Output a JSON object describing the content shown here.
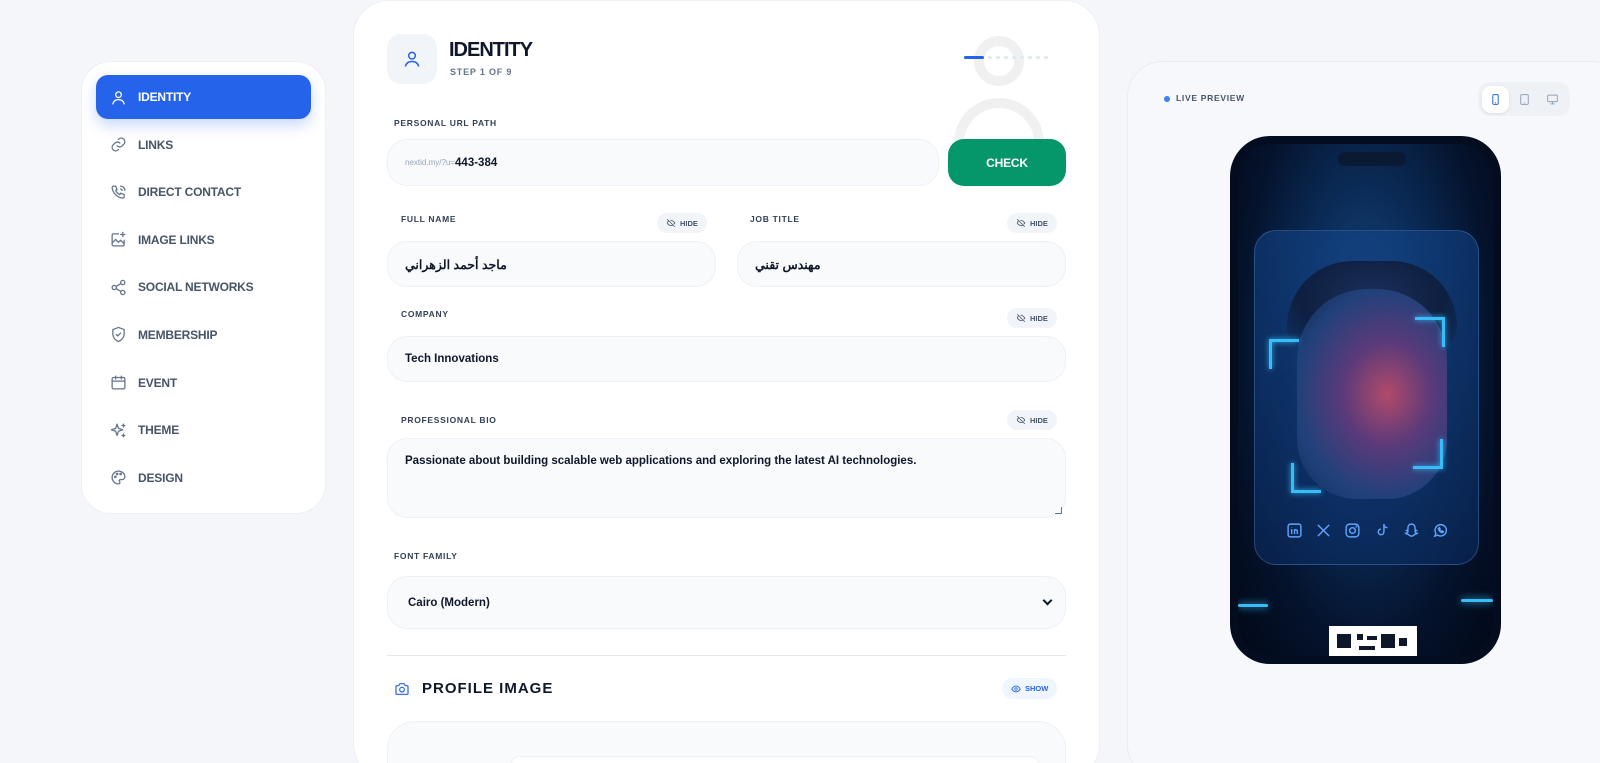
{
  "sidebar": {
    "items": [
      {
        "label": "IDENTITY",
        "icon": "user-icon",
        "active": true
      },
      {
        "label": "LINKS",
        "icon": "link-icon"
      },
      {
        "label": "DIRECT CONTACT",
        "icon": "phone-icon"
      },
      {
        "label": "IMAGE LINKS",
        "icon": "image-plus-icon"
      },
      {
        "label": "SOCIAL NETWORKS",
        "icon": "share-icon"
      },
      {
        "label": "MEMBERSHIP",
        "icon": "shield-check-icon"
      },
      {
        "label": "EVENT",
        "icon": "calendar-icon"
      },
      {
        "label": "THEME",
        "icon": "sparkles-icon"
      },
      {
        "label": "DESIGN",
        "icon": "palette-icon"
      }
    ]
  },
  "header": {
    "title": "IDENTITY",
    "subtitle": "STEP 1 OF 9",
    "icon": "user-icon",
    "step": 1,
    "total_steps": 9
  },
  "url": {
    "label": "PERSONAL URL PATH",
    "prefix": "nextid.my/?u=",
    "value": "443-384",
    "check_label": "CHECK"
  },
  "fields": {
    "full_name": {
      "label": "FULL NAME",
      "value": "ماجد أحمد الزهراني",
      "toggle": "HIDE"
    },
    "job_title": {
      "label": "JOB TITLE",
      "value": "مهندس تقني",
      "toggle": "HIDE"
    },
    "company": {
      "label": "COMPANY",
      "value": "Tech Innovations",
      "toggle": "HIDE"
    },
    "bio": {
      "label": "PROFESSIONAL BIO",
      "value": "Passionate about building scalable web applications and exploring the latest AI technologies.",
      "toggle": "HIDE"
    },
    "font_family": {
      "label": "FONT FAMILY",
      "value": "Cairo (Modern)"
    }
  },
  "profile_image": {
    "title": "PROFILE IMAGE",
    "toggle": "SHOW",
    "icon": "camera-icon"
  },
  "preview": {
    "label": "LIVE PREVIEW",
    "devices": [
      "mobile-icon",
      "tablet-icon",
      "desktop-icon"
    ],
    "active_device": "mobile-icon",
    "social_icons": [
      "linkedin-icon",
      "x-icon",
      "instagram-icon",
      "tiktok-icon",
      "snapchat-icon",
      "whatsapp-icon"
    ]
  },
  "colors": {
    "accent": "#2563eb",
    "check_button": "#059669",
    "background": "#f4f6f9"
  }
}
